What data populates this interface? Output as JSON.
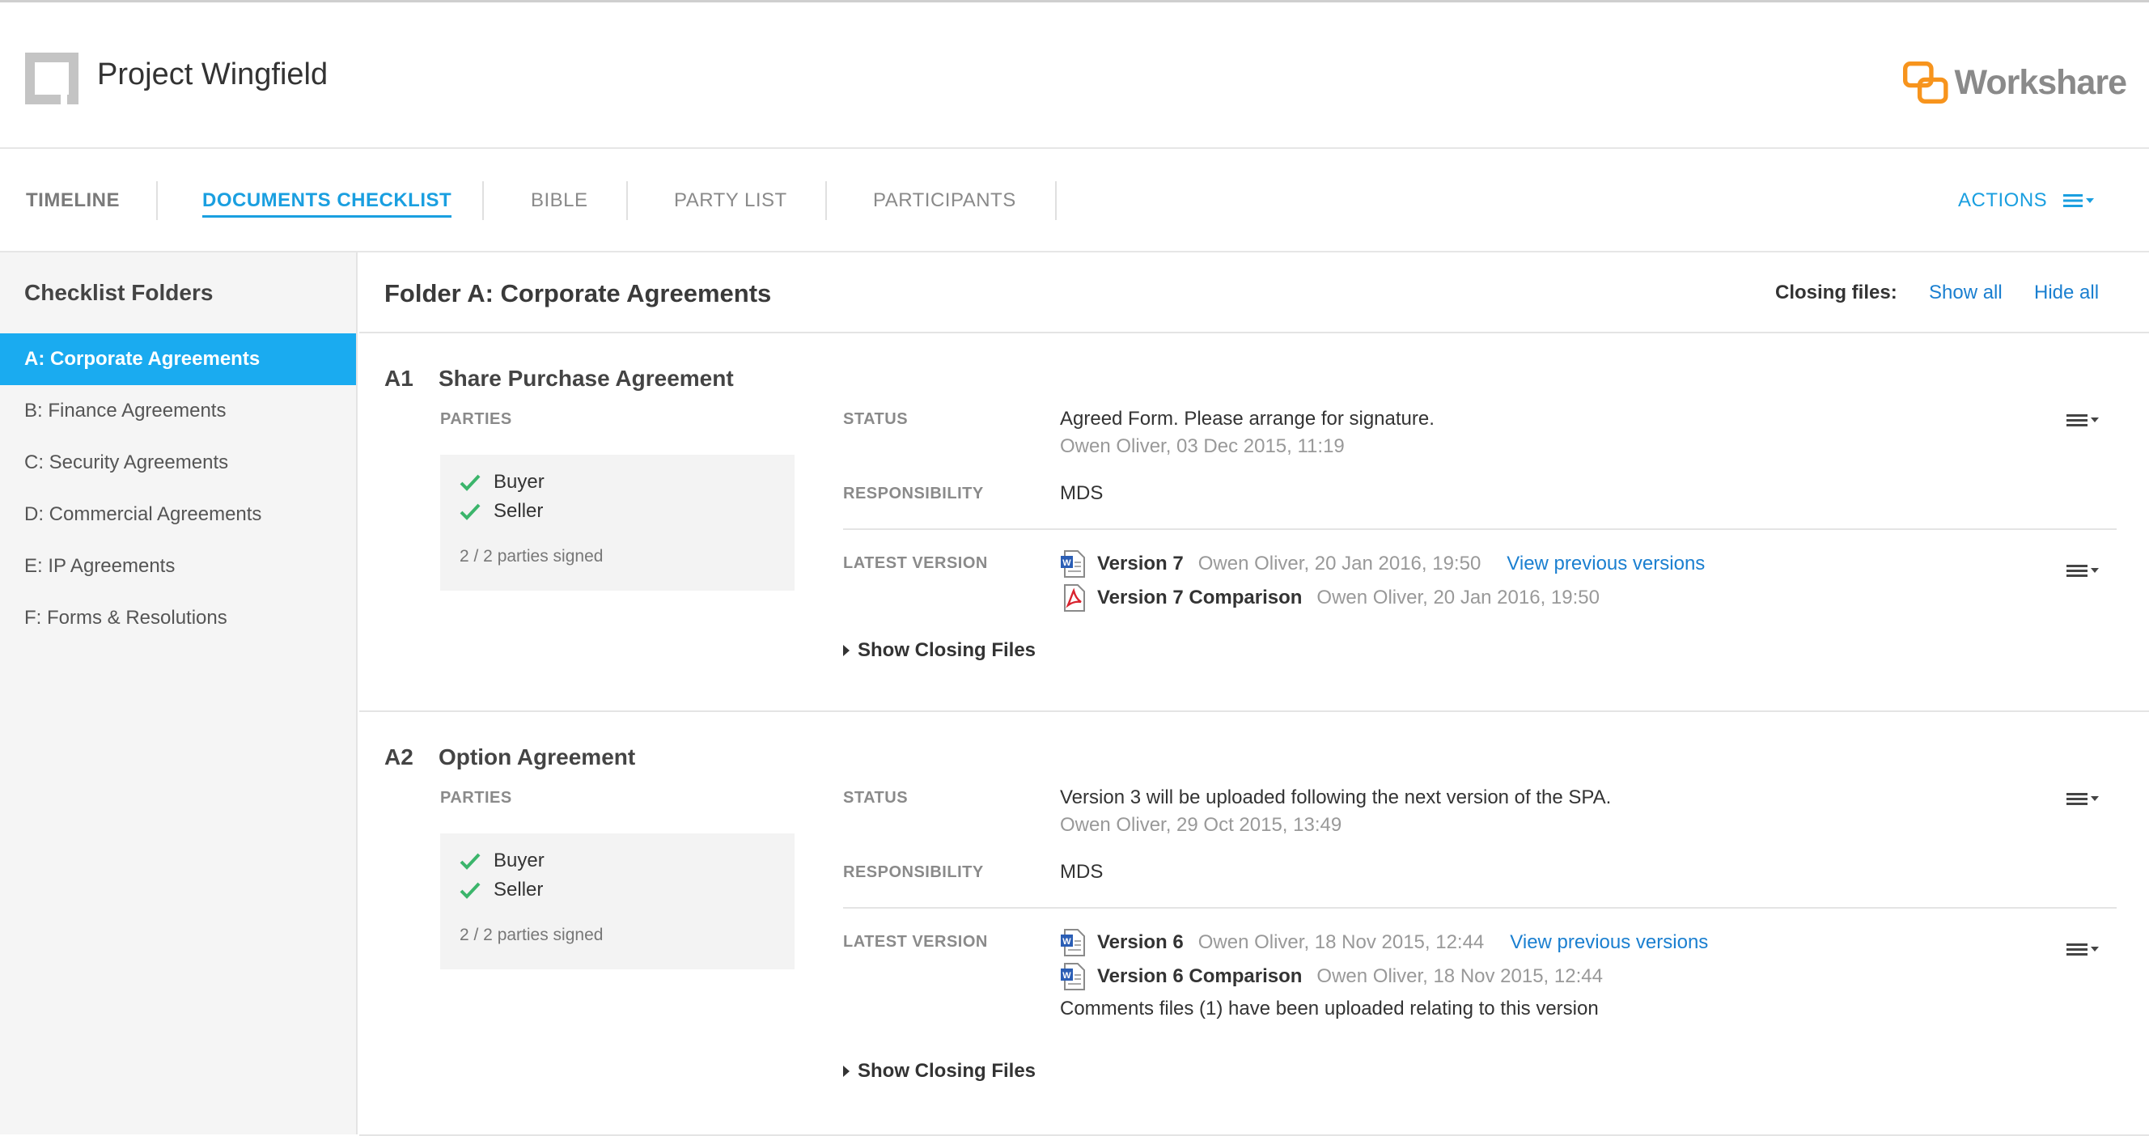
{
  "header": {
    "project_title": "Project Wingfield",
    "brand_name": "Workshare",
    "brand_color": "#f7941d"
  },
  "tabs": [
    {
      "label": "TIMELINE"
    },
    {
      "label": "DOCUMENTS CHECKLIST"
    },
    {
      "label": "BIBLE"
    },
    {
      "label": "PARTY LIST"
    },
    {
      "label": "PARTICIPANTS"
    }
  ],
  "active_tab": "DOCUMENTS CHECKLIST",
  "actions_label": "ACTIONS",
  "accent_color": "#1aabf0",
  "sidebar": {
    "title": "Checklist Folders",
    "folders": [
      {
        "label": "A: Corporate Agreements"
      },
      {
        "label": "B: Finance Agreements"
      },
      {
        "label": "C: Security Agreements"
      },
      {
        "label": "D: Commercial Agreements"
      },
      {
        "label": "E: IP Agreements"
      },
      {
        "label": "F: Forms & Resolutions"
      }
    ],
    "selected_folder": "A: Corporate Agreements"
  },
  "main": {
    "folder_title": "Folder A: Corporate Agreements",
    "closing_files_label": "Closing files:",
    "show_all": "Show all",
    "hide_all": "Hide all",
    "labels": {
      "parties": "PARTIES",
      "status": "STATUS",
      "responsibility": "RESPONSIBILITY",
      "latest_version": "LATEST VERSION",
      "show_closing_files": "Show Closing Files",
      "view_previous_versions": "View previous versions"
    },
    "items": [
      {
        "num": "A1",
        "title": "Share Purchase Agreement",
        "parties": [
          "Buyer",
          "Seller"
        ],
        "signed": "2 / 2 parties signed",
        "status_text": "Agreed Form. Please arrange for signature.",
        "status_meta": "Owen Oliver, 03 Dec 2015, 11:19",
        "responsibility": "MDS",
        "versions": [
          {
            "name": "Version 7",
            "meta": "Owen Oliver, 20 Jan 2016, 19:50",
            "icon": "word-doc-icon"
          },
          {
            "name": "Version 7 Comparison",
            "meta": "Owen Oliver, 20 Jan 2016, 19:50",
            "icon": "pdf-doc-icon"
          }
        ],
        "comments_note": ""
      },
      {
        "num": "A2",
        "title": "Option Agreement",
        "parties": [
          "Buyer",
          "Seller"
        ],
        "signed": "2 / 2 parties signed",
        "status_text": "Version 3 will be uploaded following the next version of the SPA.",
        "status_meta": "Owen Oliver, 29 Oct 2015, 13:49",
        "responsibility": "MDS",
        "versions": [
          {
            "name": "Version 6",
            "meta": "Owen Oliver, 18 Nov 2015, 12:44",
            "icon": "word-doc-icon"
          },
          {
            "name": "Version 6 Comparison",
            "meta": "Owen Oliver, 18 Nov 2015, 12:44",
            "icon": "word-doc-icon"
          }
        ],
        "comments_note": "Comments files (1) have been uploaded relating to this version"
      }
    ]
  }
}
